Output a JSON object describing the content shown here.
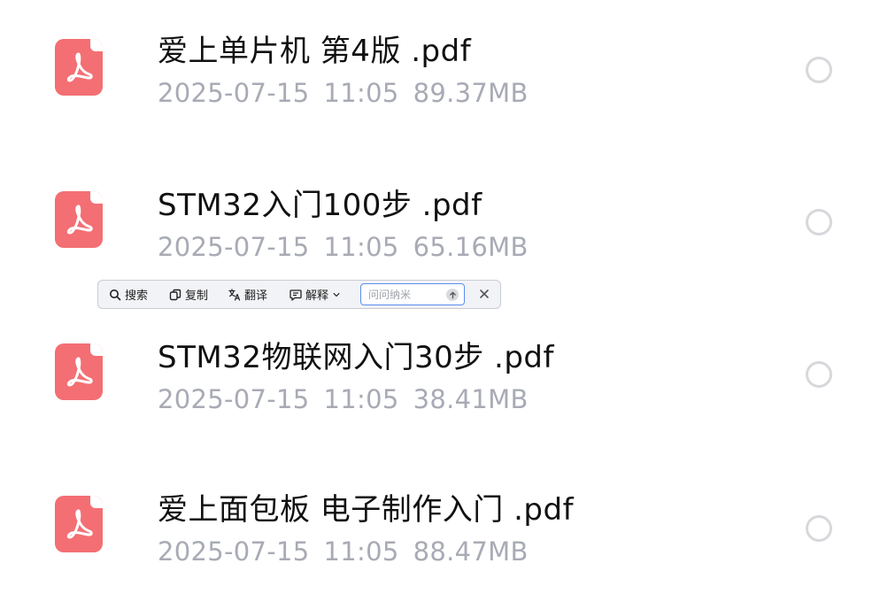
{
  "files": [
    {
      "name": "爱上单片机 第4版 .pdf",
      "date": "2025-07-15",
      "time": "11:05",
      "size": "89.37MB",
      "icon": "pdf-icon"
    },
    {
      "name": "STM32入门100步 .pdf",
      "date": "2025-07-15",
      "time": "11:05",
      "size": "65.16MB",
      "icon": "pdf-icon"
    },
    {
      "name": "STM32物联网入门30步 .pdf",
      "date": "2025-07-15",
      "time": "11:05",
      "size": "38.41MB",
      "icon": "pdf-icon"
    },
    {
      "name": "爱上面包板 电子制作入门 .pdf",
      "date": "2025-07-15",
      "time": "11:05",
      "size": "88.47MB",
      "icon": "pdf-icon"
    }
  ],
  "toolbar": {
    "search_label": "搜索",
    "copy_label": "复制",
    "translate_label": "翻译",
    "explain_label": "解释",
    "input_placeholder": "问问纳米",
    "input_value": ""
  },
  "colors": {
    "pdf_icon": "#f36f73",
    "meta_text": "#a8abb5",
    "input_border": "#5a8dee"
  }
}
